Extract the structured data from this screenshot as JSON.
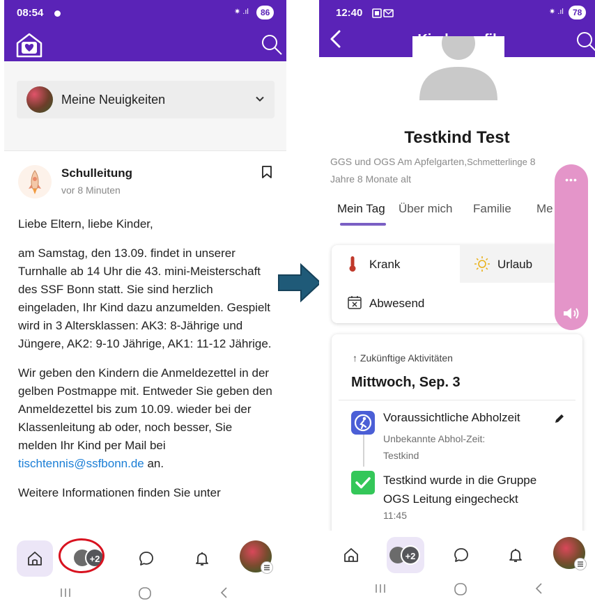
{
  "left_phone": {
    "status_bar": {
      "time": "08:54",
      "signal": "✷ .ıl",
      "battery": "86"
    },
    "feed_selector": {
      "label": "Meine Neuigkeiten"
    },
    "post": {
      "author": "Schulleitung",
      "time_ago": "vor 8 Minuten",
      "paragraphs": [
        "Liebe Eltern, liebe Kinder,",
        "am Samstag, den 13.09. findet in unserer Turnhalle ab 14 Uhr die 43. mini-Meisterschaft des SSF Bonn statt. Sie sind herzlich eingeladen, Ihr Kind dazu anzumelden. Gespielt wird in 3 Altersklassen: AK3: 8-Jährige und Jüngere, AK2: 9-10 Jährige, AK1: 11-12 Jährige.",
        "Wir geben den Kindern die Anmeldezettel in der gelben Postmappe mit. Entweder Sie geben den Anmeldezettel bis zum 10.09. wieder bei der Klassenleitung ab oder, noch besser, Sie melden Ihr Kind per Mail bei",
        "Weitere Informationen finden Sie unter"
      ],
      "email": "tischtennis@ssfbonn.de",
      "email_suffix": " an."
    },
    "bottom_nav": {
      "group_badge": "+2"
    }
  },
  "right_phone": {
    "status_bar": {
      "time": "12:40",
      "signal": "✷ .ıl",
      "battery": "78"
    },
    "app_bar": {
      "title": "Kinderprofil"
    },
    "child": {
      "name": "Testkind Test",
      "school": "GGS und OGS Am Apfelgarten,",
      "group": "Schmetterlinge",
      "age_part1": " 8",
      "age_part2": "Jahre 8 Monate alt"
    },
    "tabs": [
      "Mein Tag",
      "Über mich",
      "Familie",
      "Me"
    ],
    "status_options": {
      "sick": "Krank",
      "vacation": "Urlaub",
      "absent": "Abwesend"
    },
    "floating_panel": {
      "dots": "•••"
    },
    "activities": {
      "future_link": "↑ Zukünftige Aktivitäten",
      "day": "Mittwoch, Sep. 3",
      "pickup": {
        "title": "Voraussichtliche Abholzeit",
        "subtitle": "Unbekannte Abhol-Zeit: Testkind"
      },
      "checkin": {
        "text": "Testkind wurde in die Gruppe OGS Leitung eingecheckt",
        "time": "11:45"
      }
    },
    "bottom_nav": {
      "group_badge": "+2"
    }
  },
  "colors": {
    "brand": "#5a23b7",
    "highlight": "#d8121f",
    "arrow": "#1f5a78",
    "accent_pink": "#e495c9"
  }
}
